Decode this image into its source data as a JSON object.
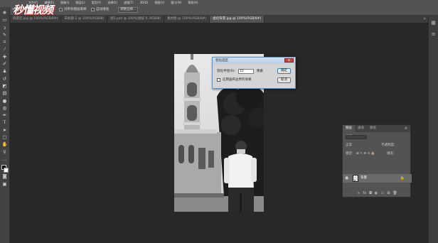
{
  "menu": [
    "文件(F)",
    "编辑(E)",
    "图像(I)",
    "图层(L)",
    "类型(Y)",
    "选择(S)",
    "滤镜(T)",
    "3D(D)",
    "视图(V)",
    "窗口(W)",
    "帮助(H)"
  ],
  "logo_text": "秒懂视频",
  "options": {
    "sample_all_layers": "对所有图层取样",
    "auto_enhance": "自动增强",
    "refine_edge": "调整边缘..."
  },
  "tabs": [
    {
      "label": "风景区.jpg @ 100%(RGB/8#)",
      "active": false
    },
    {
      "label": "未标题-2 @ 100%(RGB/8)",
      "active": false
    },
    {
      "label": "图1.psd @ 100%(图层 0, RGB/8)",
      "active": false
    },
    {
      "label": "素材图 @ 100%(RGB/8#)",
      "active": false
    },
    {
      "label": "虚化背景.jpg @ 100%(RGB/8#)",
      "active": true
    }
  ],
  "dialog": {
    "title": "羽化选区",
    "radius_label": "羽化半径(R):",
    "radius_value": "15",
    "unit": "像素",
    "edge_option": "应用画布边界的效果",
    "ok_label": "确定",
    "cancel_label": "取消"
  },
  "layers_panel": {
    "tabs": [
      "图层",
      "通道",
      "路径"
    ],
    "kind_label": "类型",
    "blend_mode": "正常",
    "opacity_label": "不透明度:",
    "lock_label": "锁定:",
    "fill_label": "填充:",
    "layer_name": "背景"
  },
  "colors": {
    "app_bg": "#282828",
    "panel_bg": "#535353",
    "dialog_bg": "#d4d4d4",
    "close_red": "#c8463b"
  }
}
